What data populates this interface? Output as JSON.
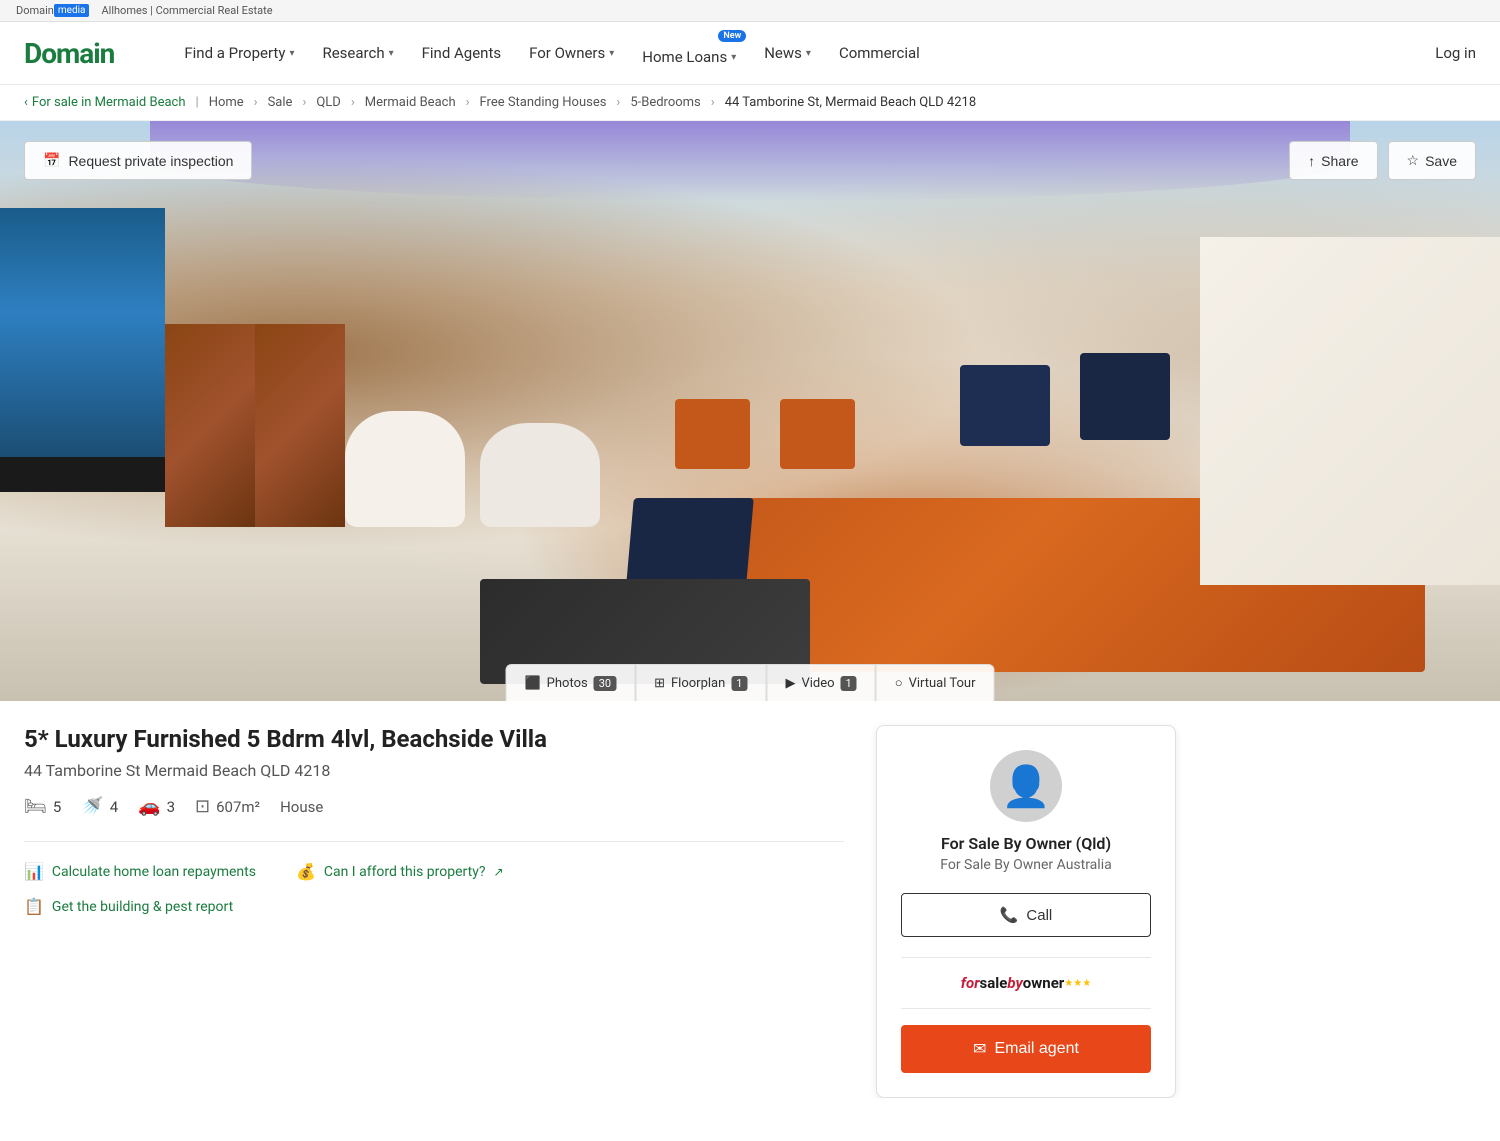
{
  "topbar": {
    "domain_word": "Domain",
    "media_badge": "media",
    "links": "Allhomes | Commercial Real Estate"
  },
  "nav": {
    "logo": "Domain",
    "items": [
      {
        "label": "Find a Property",
        "has_dropdown": true
      },
      {
        "label": "Research",
        "has_dropdown": true
      },
      {
        "label": "Find Agents",
        "has_dropdown": false
      },
      {
        "label": "For Owners",
        "has_dropdown": true
      },
      {
        "label": "Home Loans",
        "has_dropdown": true,
        "badge": "New"
      },
      {
        "label": "News",
        "has_dropdown": true
      },
      {
        "label": "Commercial",
        "has_dropdown": false
      }
    ],
    "login_label": "Log in"
  },
  "breadcrumb": {
    "back_label": "For sale in Mermaid Beach",
    "items": [
      "Home",
      "Sale",
      "QLD",
      "Mermaid Beach",
      "Free Standing Houses",
      "5-Bedrooms",
      "44 Tamborine St, Mermaid Beach QLD 4218"
    ]
  },
  "hero": {
    "request_btn": "Request private inspection",
    "share_btn": "Share",
    "save_btn": "Save",
    "tabs": [
      {
        "icon": "photos",
        "label": "Photos",
        "count": "30"
      },
      {
        "icon": "floorplan",
        "label": "Floorplan",
        "count": "1"
      },
      {
        "icon": "video",
        "label": "Video",
        "count": "1"
      },
      {
        "icon": "tour",
        "label": "Virtual Tour",
        "count": ""
      }
    ]
  },
  "property": {
    "title": "5* Luxury Furnished 5 Bdrm 4lvl, Beachside Villa",
    "address": "44 Tamborine St Mermaid Beach QLD 4218",
    "bedrooms": "5",
    "bathrooms": "4",
    "garages": "3",
    "land_size": "607m²",
    "property_type": "House",
    "actions": {
      "loan_repayments": "Calculate home loan repayments",
      "afford": "Can I afford this property?",
      "building_pest": "Get the building & pest report"
    }
  },
  "agent": {
    "name": "For Sale By Owner (Qld)",
    "company": "For Sale By Owner Australia",
    "call_label": "Call",
    "email_label": "Email agent"
  }
}
